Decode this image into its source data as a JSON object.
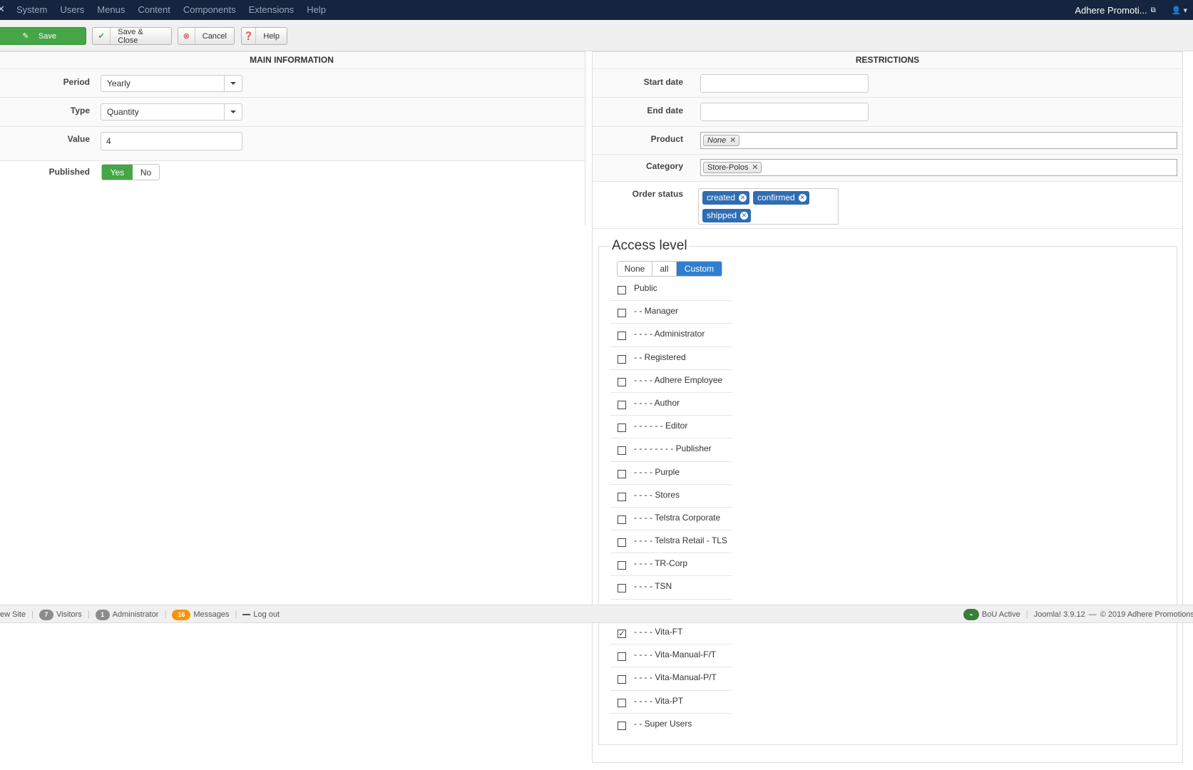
{
  "navbar": {
    "menu": [
      "System",
      "Users",
      "Menus",
      "Content",
      "Components",
      "Extensions",
      "Help"
    ],
    "site_name": "Adhere Promoti...",
    "external_link_icon": "external-link-icon",
    "user_icon": "user-icon"
  },
  "toolbar": {
    "save_label": "Save",
    "save_close_label": "Save & Close",
    "cancel_label": "Cancel",
    "help_label": "Help"
  },
  "main_info": {
    "title": "MAIN INFORMATION",
    "period": {
      "label": "Period",
      "value": "Yearly"
    },
    "type": {
      "label": "Type",
      "value": "Quantity"
    },
    "value": {
      "label": "Value",
      "value": "4"
    },
    "published": {
      "label": "Published",
      "yes": "Yes",
      "no": "No",
      "selected": "Yes"
    }
  },
  "restrictions": {
    "title": "RESTRICTIONS",
    "start_date": {
      "label": "Start date",
      "value": ""
    },
    "end_date": {
      "label": "End date",
      "value": ""
    },
    "product": {
      "label": "Product",
      "chips": [
        "None"
      ]
    },
    "category": {
      "label": "Category",
      "chips": [
        "Store-Polos"
      ]
    },
    "order_status": {
      "label": "Order status",
      "chips": [
        "created",
        "confirmed",
        "shipped"
      ]
    }
  },
  "access_level": {
    "title": "Access level",
    "options": [
      "None",
      "all",
      "Custom"
    ],
    "selected_option": "Custom",
    "groups_top": [
      {
        "label": "Public",
        "checked": false
      },
      {
        "label": "- - Manager",
        "checked": false
      },
      {
        "label": "- - - - Administrator",
        "checked": false
      },
      {
        "label": "- - Registered",
        "checked": false
      },
      {
        "label": "- - - - Adhere Employee",
        "checked": false
      },
      {
        "label": "- - - - Author",
        "checked": false
      },
      {
        "label": "- - - - - - Editor",
        "checked": false
      },
      {
        "label": "- - - - - - - - Publisher",
        "checked": false
      },
      {
        "label": "- - - - Purple",
        "checked": false
      },
      {
        "label": "- - - - Stores",
        "checked": false
      },
      {
        "label": "- - - - Telstra Corporate",
        "checked": false
      },
      {
        "label": "- - - - Telstra Retail - TLS",
        "checked": false
      },
      {
        "label": "- - - - TR-Corp",
        "checked": false
      },
      {
        "label": "- - - - TSN",
        "checked": false
      }
    ],
    "groups_bottom": [
      {
        "label": "- - - - Vita-FT",
        "checked": true
      },
      {
        "label": "- - - - Vita-Manual-F/T",
        "checked": false
      },
      {
        "label": "- - - - Vita-Manual-P/T",
        "checked": false
      },
      {
        "label": "- - - - Vita-PT",
        "checked": false
      },
      {
        "label": "- - Super Users",
        "checked": false
      }
    ]
  },
  "statusbar": {
    "view_site": "ew Site",
    "visitors_count": "7",
    "visitors_label": "Visitors",
    "admin_count": "1",
    "admin_label": "Administrator",
    "messages_count": "16",
    "messages_label": "Messages",
    "logout_label": "Log out",
    "bou_label": "BoU Active",
    "version_text": "Joomla! 3.9.12",
    "dash": "—",
    "copyright": "© 2019 Adhere Promotions"
  },
  "colors": {
    "navbar_bg": "#15253f",
    "save_green": "#46a546",
    "chip_blue": "#2f6db3",
    "custom_blue": "#2f7fd0",
    "messages_orange": "#f89406"
  }
}
